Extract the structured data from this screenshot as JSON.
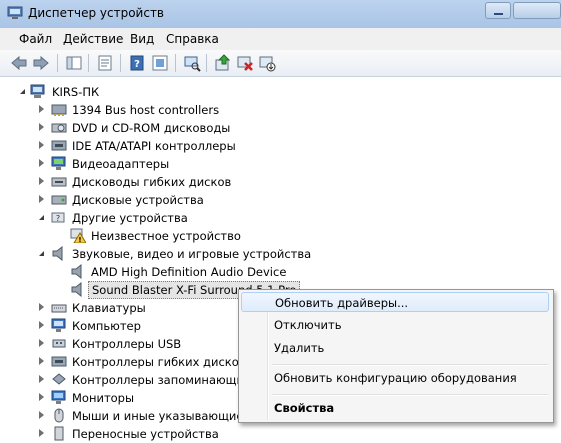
{
  "window": {
    "title": "Диспетчер устройств"
  },
  "menubar": {
    "items": [
      "Файл",
      "Действие",
      "Вид",
      "Справка"
    ]
  },
  "toolbar": {
    "buttons": [
      "back-icon",
      "forward-icon",
      "console-tree-icon",
      "properties-icon",
      "help-icon",
      "show-hide-icon",
      "scan-hardware-icon",
      "update-driver-icon",
      "uninstall-icon",
      "disable-icon"
    ]
  },
  "tree": {
    "root": "KIRS-ПК",
    "items": [
      "1394 Bus host controllers",
      "DVD и CD-ROM дисководы",
      "IDE ATA/ATAPI контроллеры",
      "Видеоадаптеры",
      "Дисководы гибких дисков",
      "Дисковые устройства",
      "Другие устройства",
      "Неизвестное устройство",
      "Звуковые, видео и игровые устройства",
      "AMD High Definition Audio Device",
      "Sound Blaster X-Fi Surround 5.1 Pro",
      "Клавиатуры",
      "Компьютер",
      "Контроллеры USB",
      "Контроллеры гибких дисков",
      "Контроллеры запоминающих устройств",
      "Мониторы",
      "Мыши и иные указывающие устройства",
      "Переносные устройства"
    ]
  },
  "context_menu": {
    "update": "Обновить драйверы...",
    "disable": "Отключить",
    "uninstall": "Удалить",
    "scan": "Обновить конфигурацию оборудования",
    "properties": "Свойства"
  },
  "colors": {
    "titlebar": "#bcd3ee",
    "highlight": "#dfecfb",
    "selection": "#e5e5e5"
  }
}
